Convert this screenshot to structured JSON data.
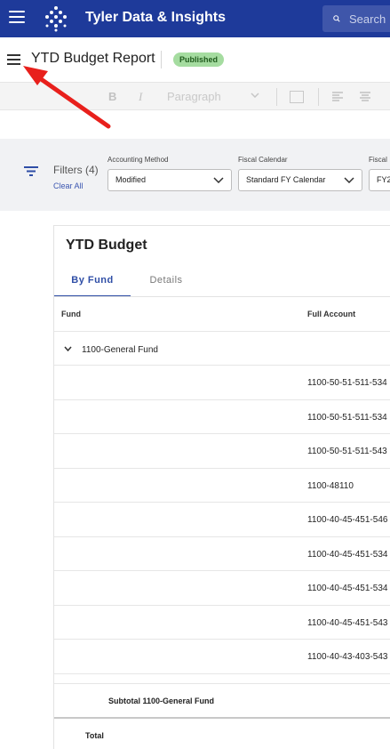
{
  "appbar": {
    "brand": "Tyler Data & Insights",
    "search_placeholder": "Search",
    "color": "#1e3a9a"
  },
  "page": {
    "title": "YTD Budget Report",
    "status": "Published"
  },
  "toolbar": {
    "bold": "B",
    "italic": "I",
    "paragraph": "Paragraph"
  },
  "filters": {
    "label": "Filters (4)",
    "clear_all": "Clear All",
    "items": [
      {
        "label": "Accounting Method",
        "value": "Modified"
      },
      {
        "label": "Fiscal Calendar",
        "value": "Standard FY Calendar"
      },
      {
        "label": "Fiscal",
        "value": "FY2"
      }
    ]
  },
  "report": {
    "title": "YTD Budget",
    "tabs": [
      "By Fund",
      "Details"
    ],
    "columns": [
      "Fund",
      "Full Account"
    ],
    "group": "1100-General Fund",
    "accounts": [
      "1100-50-51-511-534",
      "1100-50-51-511-534",
      "1100-50-51-511-543",
      "1100-48110",
      "1100-40-45-451-546",
      "1100-40-45-451-534",
      "1100-40-45-451-534",
      "1100-40-45-451-543",
      "1100-40-43-403-543"
    ],
    "subtotal": "Subtotal 1100-General Fund",
    "total": "Total"
  },
  "icons": {
    "menu": "hamburger-icon",
    "logo": "tyler-logo-icon",
    "search": "search-icon",
    "filter": "filter-icon",
    "annotation": "red-arrow-pointer"
  }
}
